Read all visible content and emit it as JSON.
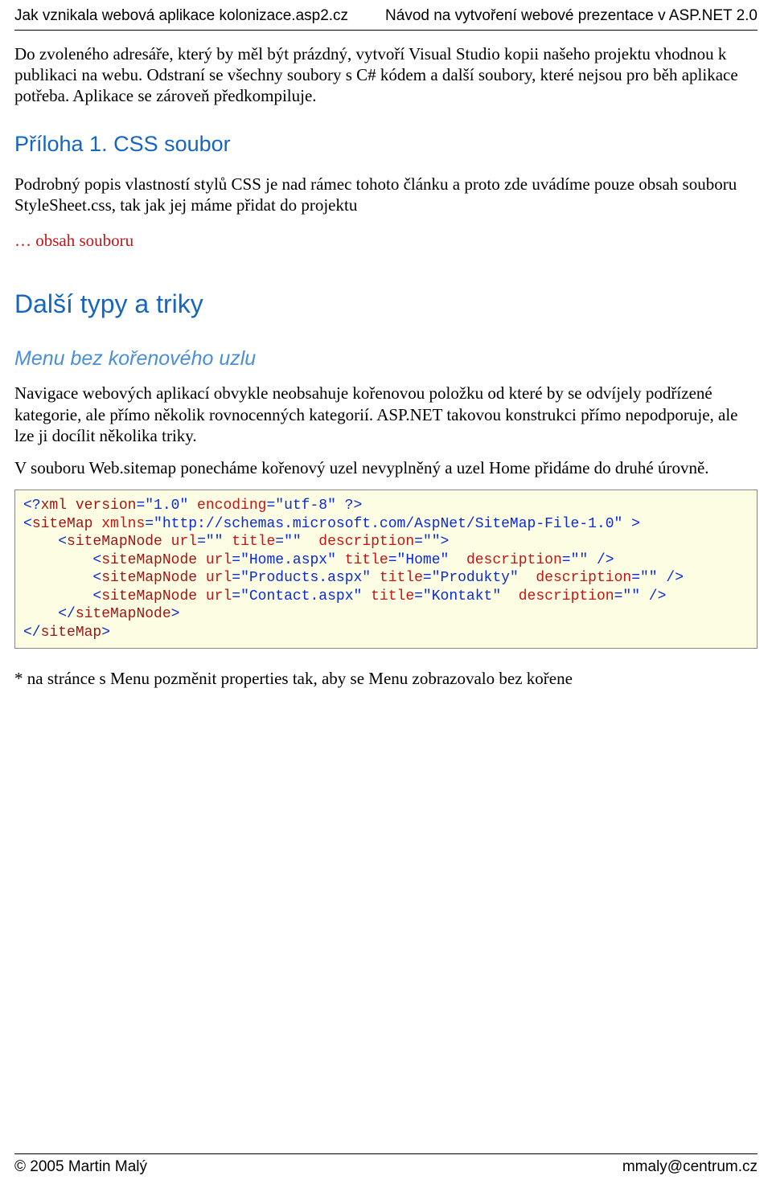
{
  "header": {
    "left": "Jak vznikala webová aplikace kolonizace.asp2.cz",
    "right": "Návod na vytvoření webové prezentace v ASP.NET 2.0"
  },
  "para1": "Do zvoleného adresáře, který by měl být prázdný, vytvoří Visual Studio kopii našeho projektu vhodnou k publikaci na webu. Odstraní se všechny soubory s C# kódem a další soubory, které nejsou pro běh aplikace potřeba. Aplikace se zároveň předkompiluje.",
  "h_priloha": "Příloha 1. CSS soubor",
  "para2": "Podrobný popis vlastností stylů CSS je nad rámec tohoto článku a proto zde uvádíme pouze obsah souboru StyleSheet.css, tak jak jej máme přidat do projektu",
  "red_note": "… obsah souboru",
  "h_dalsi": "Další typy a triky",
  "h_menu": "Menu bez kořenového uzlu",
  "para3": "Navigace webových aplikací obvykle neobsahuje kořenovou položku od které by se odvíjely podřízené kategorie, ale přímo několik rovnocenných kategorií. ASP.NET takovou konstrukci přímo nepodporuje, ale lze ji docílit několika triky.",
  "para4": "V souboru Web.sitemap ponecháme kořenový uzel nevyplněný a uzel Home přidáme do druhé úrovně.",
  "code": {
    "l1a": "<?",
    "l1b": "xml version",
    "l1c": "=\"1.0\"",
    "l1d": " encoding",
    "l1e": "=\"utf-8\" ?>",
    "l2a": "<",
    "l2b": "siteMap",
    "l2c": " xmlns",
    "l2d": "=\"http://schemas.microsoft.com/AspNet/SiteMap-File-1.0\" >",
    "l3a": "    <",
    "l3b": "siteMapNode",
    "l3c": " url",
    "l3d": "=\"\"",
    "l3e": " title",
    "l3f": "=\"\"",
    "l3g": "  description",
    "l3h": "=\"\">",
    "l4a": "        <",
    "l4b": "siteMapNode",
    "l4c": " url",
    "l4d": "=\"Home.aspx\"",
    "l4e": " title",
    "l4f": "=\"Home\"",
    "l4g": "  description",
    "l4h": "=\"\" />",
    "l5a": "        <",
    "l5b": "siteMapNode",
    "l5c": " url",
    "l5d": "=\"Products.aspx\"",
    "l5e": " title",
    "l5f": "=\"Produkty\"",
    "l5g": "  description",
    "l5h": "=\"\" />",
    "l6a": "        <",
    "l6b": "siteMapNode",
    "l6c": " url",
    "l6d": "=\"Contact.aspx\"",
    "l6e": " title",
    "l6f": "=\"Kontakt\"",
    "l6g": "  description",
    "l6h": "=\"\" />",
    "l7a": "    </",
    "l7b": "siteMapNode",
    "l7c": ">",
    "l8a": "</",
    "l8b": "siteMap",
    "l8c": ">"
  },
  "para5": "* na stránce s Menu pozměnit properties tak, aby se Menu zobrazovalo bez kořene",
  "footer": {
    "left": "© 2005 Martin Malý",
    "right": "mmaly@centrum.cz"
  }
}
